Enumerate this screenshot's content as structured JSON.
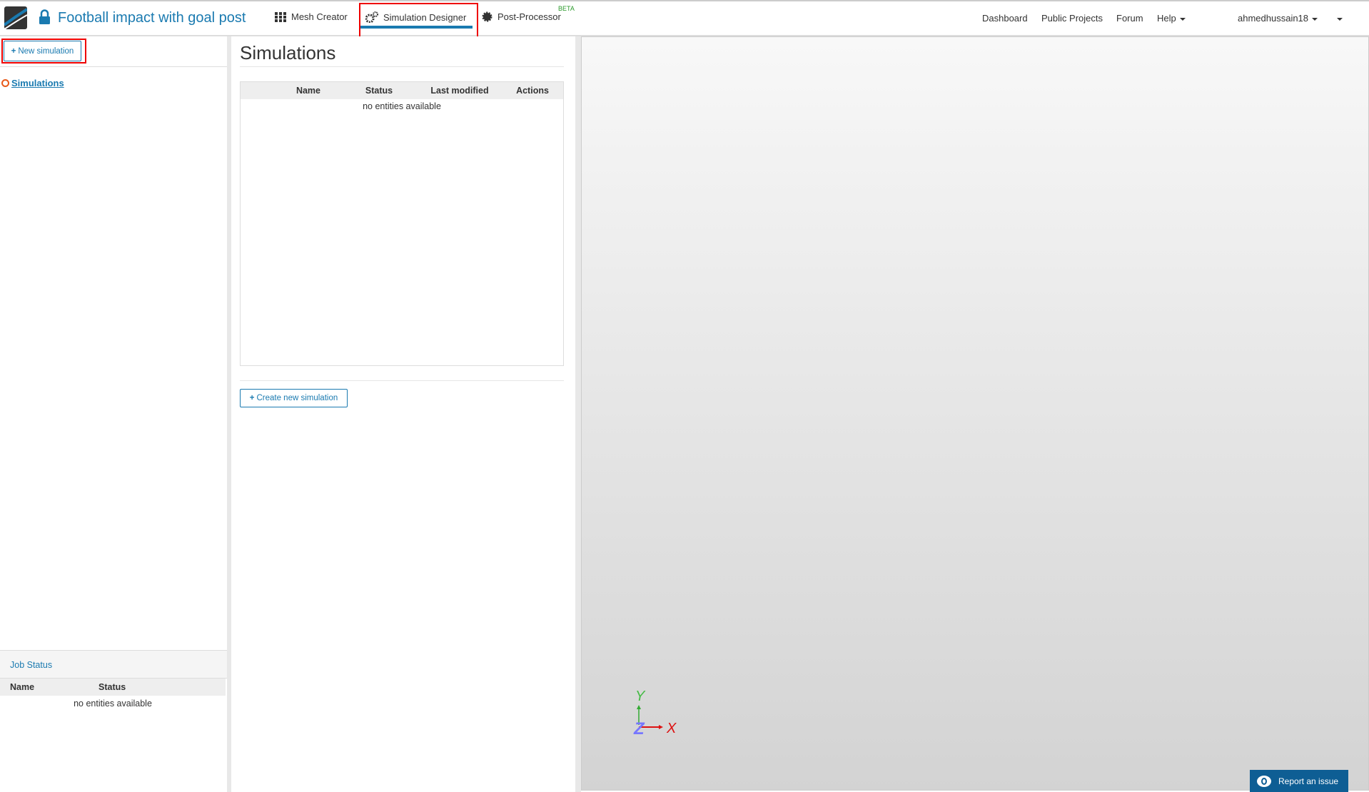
{
  "header": {
    "project_title": "Football impact with goal post",
    "tabs": [
      {
        "label": "Mesh Creator",
        "icon": "grid-icon"
      },
      {
        "label": "Simulation Designer",
        "icon": "gears-icon",
        "active": true
      },
      {
        "label": "Post-Processor",
        "icon": "gear-icon",
        "badge": "BETA"
      }
    ],
    "nav": {
      "dashboard": "Dashboard",
      "public_projects": "Public Projects",
      "forum": "Forum",
      "help": "Help",
      "user": "ahmedhussain18"
    }
  },
  "left": {
    "new_simulation": "New simulation",
    "tree_item": "Simulations",
    "job_status": {
      "title": "Job Status",
      "columns": [
        "Name",
        "Status"
      ],
      "empty": "no entities available"
    }
  },
  "middle": {
    "title": "Simulations",
    "columns": [
      "Name",
      "Status",
      "Last modified",
      "Actions"
    ],
    "empty": "no entities available",
    "create_button": "Create new simulation"
  },
  "viewport": {
    "axes": {
      "x": "X",
      "y": "Y",
      "z": "Z"
    },
    "report_button": "Report an issue"
  },
  "colors": {
    "accent": "#1a7ab0",
    "highlight": "#e00000"
  }
}
